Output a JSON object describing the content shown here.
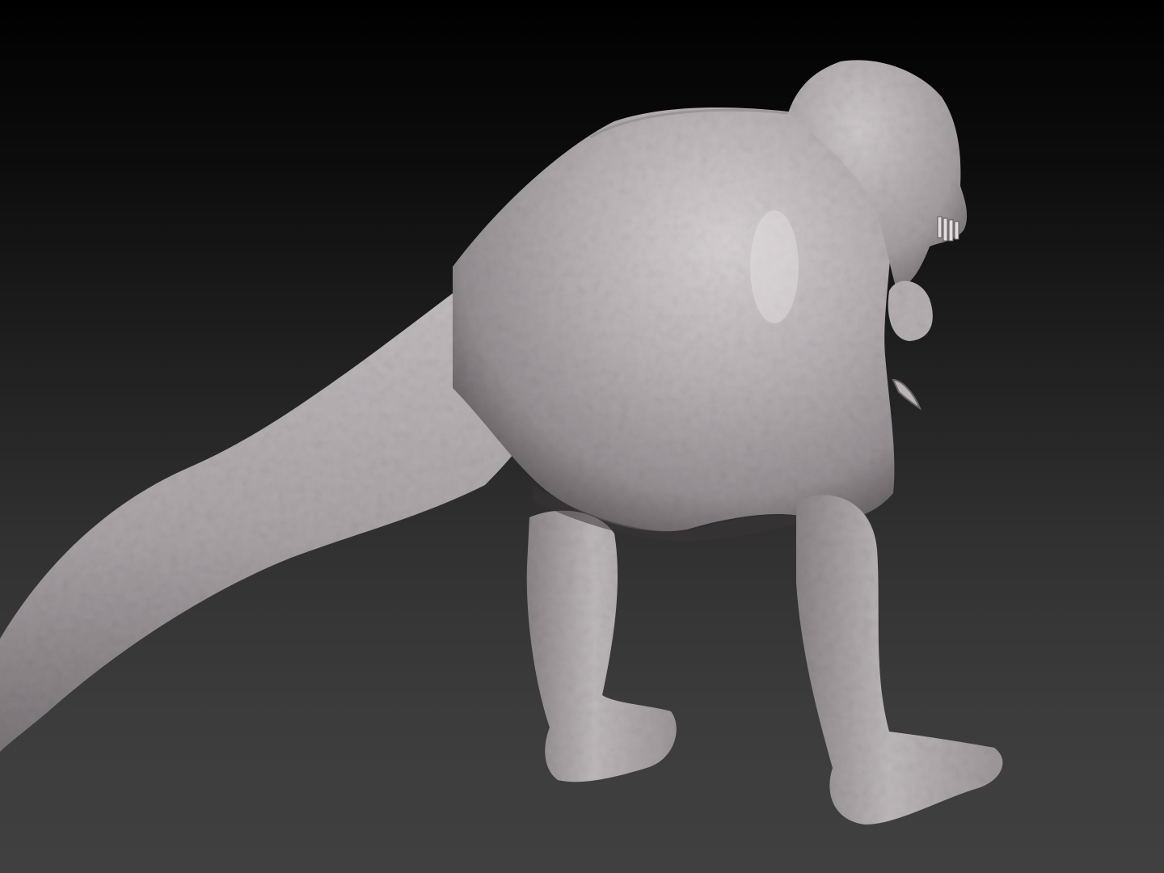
{
  "scene": {
    "subject": "sculpt-mesh",
    "colors": {
      "background_top": "#000000",
      "background_bottom": "#404040",
      "material_light": "#c9c4c6",
      "material_mid": "#a8a2a5",
      "material_dark": "#6e686b",
      "shadow": "#2a2627"
    }
  }
}
